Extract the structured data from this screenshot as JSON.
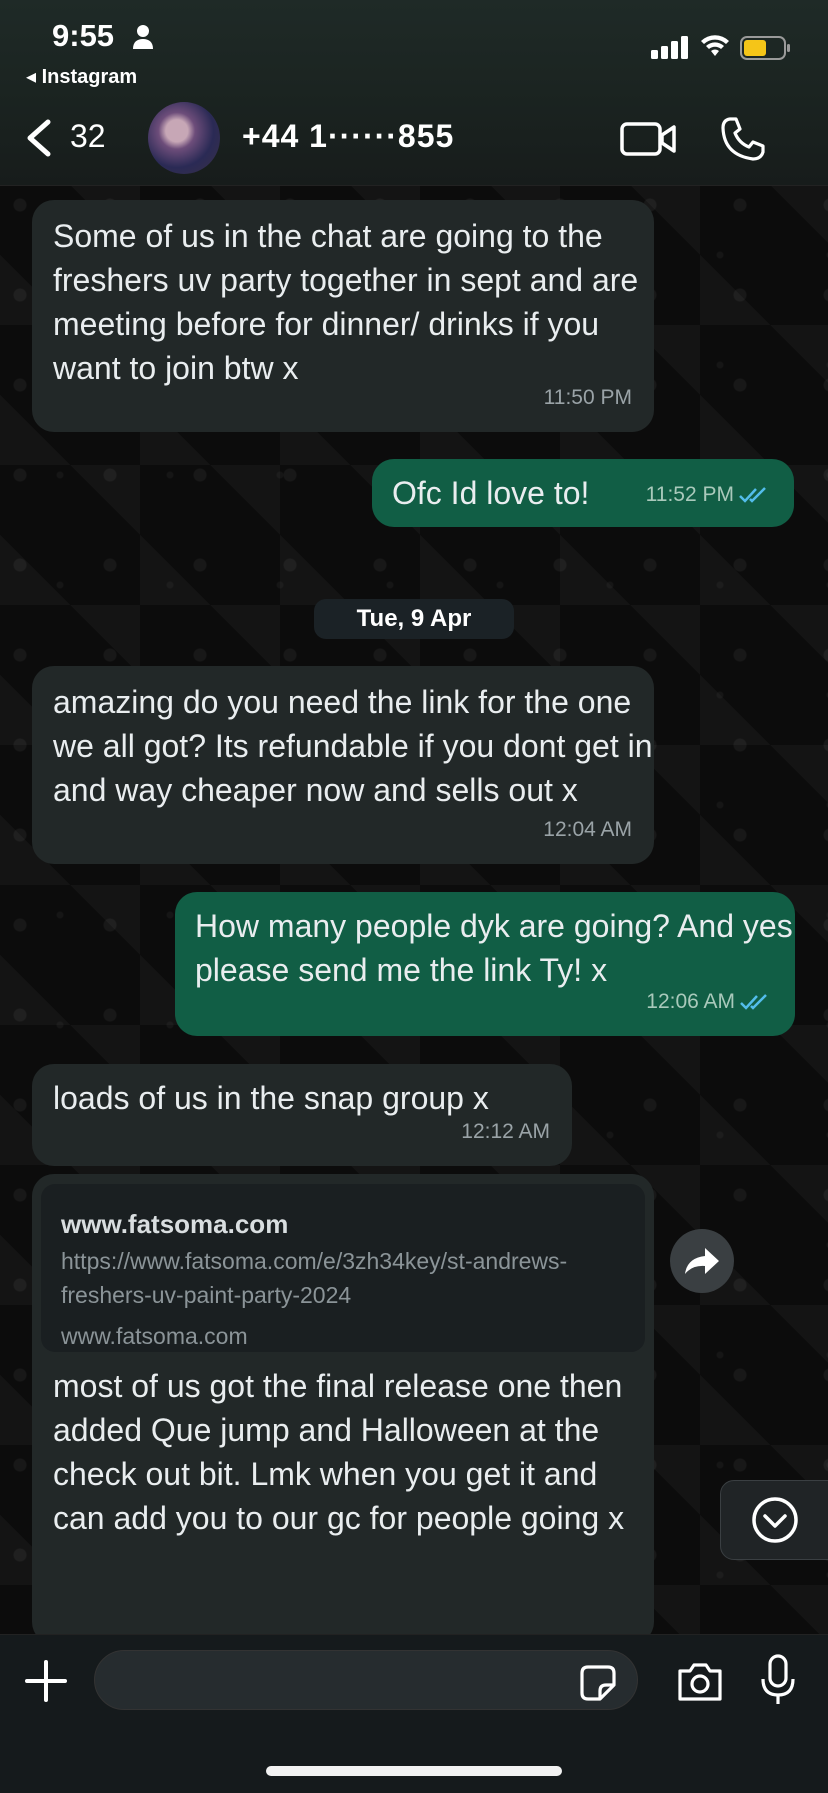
{
  "status_bar": {
    "time": "9:55",
    "back_app": "◂ Instagram"
  },
  "header": {
    "unread_count": "32",
    "contact_name": "+44 1······855"
  },
  "messages": [
    {
      "dir": "in",
      "text": "Some of us in the chat are going to the freshers uv party together in sept and are meeting before for dinner/ drinks if you want to join btw x",
      "time": "11:50 PM"
    },
    {
      "dir": "out",
      "text": "Ofc Id love to!",
      "time": "11:52 PM"
    },
    {
      "dir": "date",
      "text": "Tue, 9 Apr"
    },
    {
      "dir": "in",
      "text": "amazing do you need the link for the one we all got? Its refundable if you dont get in and way cheaper now and sells out x",
      "time": "12:04 AM"
    },
    {
      "dir": "out",
      "text": "How many people dyk are going? And yes please send me the link Ty! x",
      "time": "12:06 AM"
    },
    {
      "dir": "in",
      "text": "loads of us in the snap group x",
      "time": "12:12 AM"
    },
    {
      "dir": "in",
      "link_preview": {
        "domain": "www.fatsoma.com",
        "url": "https://www.fatsoma.com/e/3zh34key/st-andrews-freshers-uv-paint-party-2024",
        "site": "www.fatsoma.com"
      },
      "text": "most of us got the final release one then added Que jump and Halloween at the check out bit. Lmk when you get it and can add you to our gc for people going x"
    }
  ],
  "composer": {
    "placeholder": ""
  },
  "colors": {
    "incoming_bubble": "#222828",
    "outgoing_bubble": "#115e45",
    "read_ticks": "#53bdeb"
  }
}
